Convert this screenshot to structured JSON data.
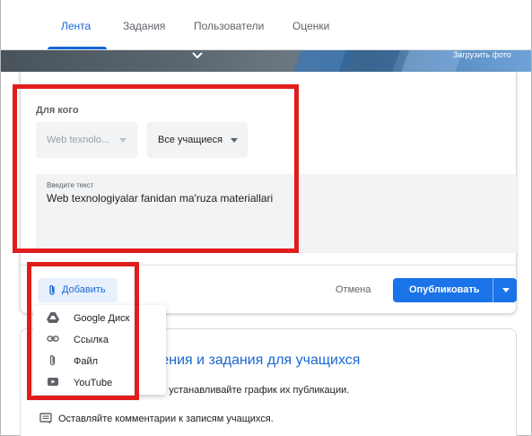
{
  "tabs": [
    {
      "label": "Лента",
      "active": true
    },
    {
      "label": "Задания",
      "active": false
    },
    {
      "label": "Пользователи",
      "active": false
    },
    {
      "label": "Оценки",
      "active": false
    }
  ],
  "banner": {
    "upload_label": "Загрузить фото"
  },
  "composer": {
    "for_whom_label": "Для кого",
    "class_select": {
      "value": "Web texnolo..."
    },
    "students_select": {
      "value": "Все учащиеся"
    },
    "text_field": {
      "label": "Введите текст",
      "value": "Web texnologiyalar fanidan ma'ruza materiallari"
    },
    "add_label": "Добавить",
    "cancel_label": "Отмена",
    "publish_label": "Опубликовать"
  },
  "add_menu": {
    "items": [
      {
        "label": "Google Диск",
        "icon": "google-drive-icon"
      },
      {
        "label": "Ссылка",
        "icon": "link-icon"
      },
      {
        "label": "Файл",
        "icon": "attachment-icon"
      },
      {
        "label": "YouTube",
        "icon": "youtube-icon"
      }
    ]
  },
  "info_card": {
    "title": "ления и задания для учащихся",
    "line1": "я и устанавливайте график их публикации.",
    "line2": "Оставляйте комментарии к записям учащихся."
  },
  "colors": {
    "accent": "#1967d2",
    "primary_button": "#1a73e8",
    "annotation": "#e01c1c"
  }
}
